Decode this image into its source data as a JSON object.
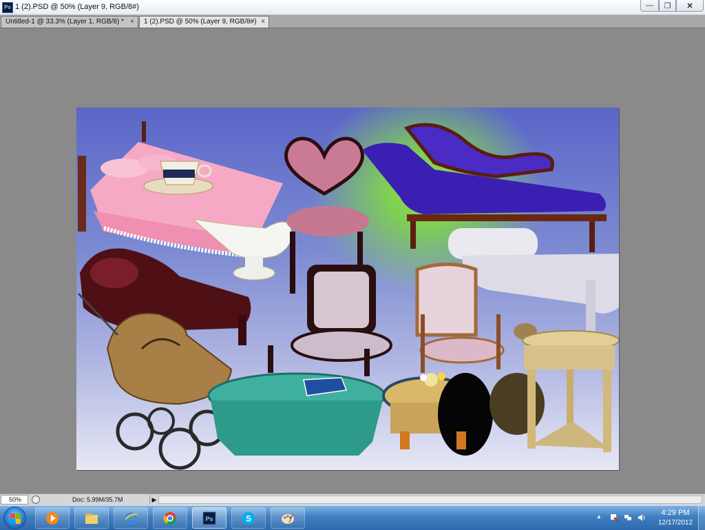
{
  "window": {
    "title": "1 (2).PSD @ 50% (Layer 9, RGB/8#)",
    "app_icon_label": "Ps",
    "minimize_glyph": "—",
    "restore_glyph": "❐",
    "close_glyph": "✕"
  },
  "tabs": [
    {
      "label": "Untitled-1 @ 33.3% (Layer 1, RGB/8) *",
      "close": "×",
      "active": false
    },
    {
      "label": "1 (2).PSD @ 50% (Layer 9, RGB/8#)",
      "close": "×",
      "active": true
    }
  ],
  "status": {
    "zoom": "50%",
    "doc_info": "Doc: 5.99M/35.7M",
    "arrow": "▶"
  },
  "taskbar": {
    "apps": [
      {
        "name": "media-player",
        "active": false
      },
      {
        "name": "file-explorer",
        "active": false
      },
      {
        "name": "internet-explorer",
        "active": false
      },
      {
        "name": "chrome",
        "active": false
      },
      {
        "name": "photoshop",
        "active": true
      },
      {
        "name": "skype",
        "active": false
      },
      {
        "name": "paint",
        "active": false
      }
    ],
    "tray": {
      "up_arrow": "▲",
      "time": "4:29 PM",
      "date": "12/17/2012"
    }
  },
  "colors": {
    "canvas_top": "#5b66c8",
    "canvas_glow": "#93e33a",
    "workspace_bg": "#8a8a8a",
    "taskbar": "#3f7ec0"
  }
}
